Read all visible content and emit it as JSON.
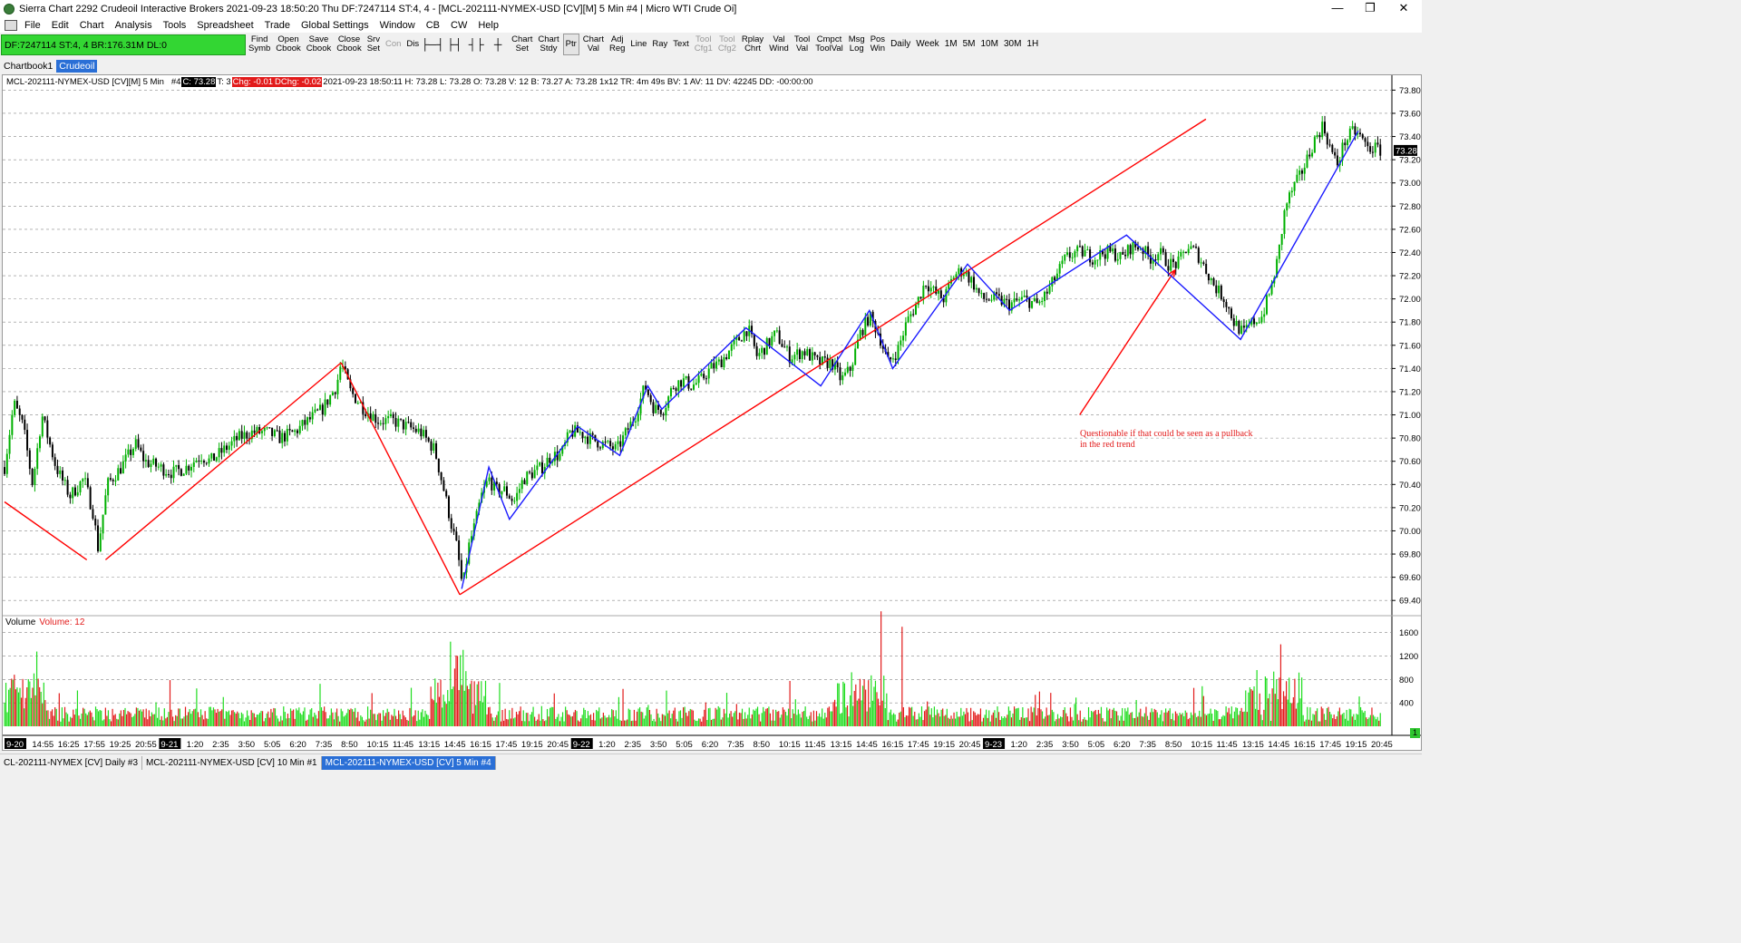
{
  "window": {
    "title": "Sierra Chart 2292 Crudeoil  Interactive Brokers 2021-09-23  18:50:20 Thu  DF:7247114  ST:4, 4 - [MCL-202111-NYMEX-USD [CV][M]  5 Min  #4 | Micro WTI Crude Oi]",
    "minimize": "—",
    "restore": "❐",
    "close": "✕"
  },
  "menu": [
    "File",
    "Edit",
    "Chart",
    "Analysis",
    "Tools",
    "Spreadsheet",
    "Trade",
    "Global Settings",
    "Window",
    "CB",
    "CW",
    "Help"
  ],
  "toolbar": {
    "status": "DF:7247114  ST:4, 4  BR:176.31M  DL:0",
    "buttons": [
      {
        "l1": "Find",
        "l2": "Symb",
        "dis": false
      },
      {
        "l1": "Open",
        "l2": "Cbook",
        "dis": false
      },
      {
        "l1": "Save",
        "l2": "Cbook",
        "dis": false
      },
      {
        "l1": "Close",
        "l2": "Cbook",
        "dis": false
      },
      {
        "l1": "Srv",
        "l2": "Set",
        "dis": false
      },
      {
        "l1": "Con",
        "l2": "",
        "dis": true
      },
      {
        "l1": "Dis",
        "l2": "",
        "dis": false
      }
    ],
    "icon_buttons": [
      "├─┤",
      "├┤",
      "┤├",
      "┼"
    ],
    "buttons2": [
      {
        "l1": "Chart",
        "l2": "Set"
      },
      {
        "l1": "Chart",
        "l2": "Stdy"
      },
      {
        "l1": "Ptr",
        "l2": "",
        "pressed": true
      },
      {
        "l1": "Chart",
        "l2": "Val"
      },
      {
        "l1": "Adj",
        "l2": "Reg"
      },
      {
        "l1": "Line",
        "l2": ""
      },
      {
        "l1": "Ray",
        "l2": ""
      },
      {
        "l1": "Text",
        "l2": ""
      },
      {
        "l1": "Tool",
        "l2": "Cfg1",
        "dis": true
      },
      {
        "l1": "Tool",
        "l2": "Cfg2",
        "dis": true
      },
      {
        "l1": "Rplay",
        "l2": "Chrt"
      },
      {
        "l1": "Val",
        "l2": "Wind"
      },
      {
        "l1": "Tool",
        "l2": "Val"
      },
      {
        "l1": "Cmpct",
        "l2": "ToolVal"
      },
      {
        "l1": "Msg",
        "l2": "Log"
      },
      {
        "l1": "Pos",
        "l2": "Win"
      }
    ],
    "timeframes": [
      "Daily",
      "Week",
      "1M",
      "5M",
      "10M",
      "30M",
      "1H"
    ]
  },
  "tabs": [
    "Chartbook1",
    "Crudeoil"
  ],
  "chart_header": {
    "symbol": "MCL-202111-NYMEX-USD [CV][M]  5 Min",
    "num": "#4",
    "c": "C: 73.28",
    "t": "T: 3",
    "chg": "Chg: -0.01",
    "dchg": "DChg: -0.02",
    "info": "2021-09-23 18:50:11 H: 73.28  L: 73.28  O: 73.28  V: 12  B: 73.27  A: 73.28  1x12  TR: 4m 49s  BV: 1  AV: 11  DV: 42245  DD: -00:00:00"
  },
  "volume_label": {
    "name": "Volume",
    "value": "Volume: 12"
  },
  "annotation": {
    "line1": "Questionable if that could be seen as a pullback",
    "line2": "in the red trend"
  },
  "last_price_label": "73.28",
  "scroll_indicator": "1",
  "bottom_tabs": [
    {
      "label": "CL-202111-NYMEX [CV]  Daily  #3",
      "active": false
    },
    {
      "label": "MCL-202111-NYMEX-USD [CV]  10 Min  #1",
      "active": false
    },
    {
      "label": "MCL-202111-NYMEX-USD [CV]  5 Min  #4",
      "active": true
    }
  ],
  "colors": {
    "up": "#00b000",
    "down": "#e21b1b",
    "red_line": "#ff0000",
    "blue_line": "#1a1aff",
    "accent": "#2a6fd6",
    "status_green": "#33d633"
  },
  "chart_data": {
    "type": "candlestick",
    "price_axis": {
      "ticks": [
        "73.80",
        "73.60",
        "73.40",
        "73.20",
        "73.00",
        "72.80",
        "72.60",
        "72.40",
        "72.20",
        "72.00",
        "71.80",
        "71.60",
        "71.40",
        "71.20",
        "71.00",
        "70.80",
        "70.60",
        "70.40",
        "70.20",
        "70.00",
        "69.80",
        "69.60",
        "69.40"
      ],
      "ylim": [
        69.3,
        73.85
      ]
    },
    "volume_axis": {
      "ticks": [
        "1600",
        "1200",
        "800",
        "400"
      ],
      "ylim": [
        0,
        1750
      ]
    },
    "time_axis": {
      "labels": [
        {
          "t": "9-20",
          "boxed": true
        },
        {
          "t": "14:55"
        },
        {
          "t": "16:25"
        },
        {
          "t": "17:55"
        },
        {
          "t": "19:25"
        },
        {
          "t": "20:55"
        },
        {
          "t": "9-21",
          "boxed": true
        },
        {
          "t": "1:20"
        },
        {
          "t": "2:35"
        },
        {
          "t": "3:50"
        },
        {
          "t": "5:05"
        },
        {
          "t": "6:20"
        },
        {
          "t": "7:35"
        },
        {
          "t": "8:50"
        },
        {
          "t": "10:15"
        },
        {
          "t": "11:45"
        },
        {
          "t": "13:15"
        },
        {
          "t": "14:45"
        },
        {
          "t": "16:15"
        },
        {
          "t": "17:45"
        },
        {
          "t": "19:15"
        },
        {
          "t": "20:45"
        },
        {
          "t": "9-22",
          "boxed": true
        },
        {
          "t": "1:20"
        },
        {
          "t": "2:35"
        },
        {
          "t": "3:50"
        },
        {
          "t": "5:05"
        },
        {
          "t": "6:20"
        },
        {
          "t": "7:35"
        },
        {
          "t": "8:50"
        },
        {
          "t": "10:15"
        },
        {
          "t": "11:45"
        },
        {
          "t": "13:15"
        },
        {
          "t": "14:45"
        },
        {
          "t": "16:15"
        },
        {
          "t": "17:45"
        },
        {
          "t": "19:15"
        },
        {
          "t": "20:45"
        },
        {
          "t": "9-23",
          "boxed": true
        },
        {
          "t": "1:20"
        },
        {
          "t": "2:35"
        },
        {
          "t": "3:50"
        },
        {
          "t": "5:05"
        },
        {
          "t": "6:20"
        },
        {
          "t": "7:35"
        },
        {
          "t": "8:50"
        },
        {
          "t": "10:15"
        },
        {
          "t": "11:45"
        },
        {
          "t": "13:15"
        },
        {
          "t": "14:45"
        },
        {
          "t": "16:15"
        },
        {
          "t": "17:45"
        },
        {
          "t": "19:15"
        },
        {
          "t": "20:45"
        }
      ]
    },
    "price_path": [
      [
        0,
        70.55
      ],
      [
        10,
        71.1
      ],
      [
        20,
        70.9
      ],
      [
        30,
        70.4
      ],
      [
        40,
        71.0
      ],
      [
        55,
        70.55
      ],
      [
        70,
        70.3
      ],
      [
        85,
        70.45
      ],
      [
        95,
        70.15
      ],
      [
        100,
        69.85
      ],
      [
        110,
        70.4
      ],
      [
        125,
        70.55
      ],
      [
        140,
        70.75
      ],
      [
        150,
        70.6
      ],
      [
        165,
        70.55
      ],
      [
        180,
        70.5
      ],
      [
        195,
        70.55
      ],
      [
        210,
        70.65
      ],
      [
        220,
        70.6
      ],
      [
        235,
        70.7
      ],
      [
        250,
        70.8
      ],
      [
        265,
        70.85
      ],
      [
        280,
        70.85
      ],
      [
        295,
        70.8
      ],
      [
        310,
        70.85
      ],
      [
        325,
        70.95
      ],
      [
        340,
        71.05
      ],
      [
        355,
        71.25
      ],
      [
        360,
        71.45
      ],
      [
        370,
        71.2
      ],
      [
        385,
        71.05
      ],
      [
        400,
        70.95
      ],
      [
        415,
        70.95
      ],
      [
        430,
        70.9
      ],
      [
        445,
        70.85
      ],
      [
        460,
        70.7
      ],
      [
        470,
        70.35
      ],
      [
        478,
        70.05
      ],
      [
        484,
        69.85
      ],
      [
        490,
        69.5
      ],
      [
        496,
        69.85
      ],
      [
        503,
        70.05
      ],
      [
        510,
        70.3
      ],
      [
        518,
        70.45
      ],
      [
        525,
        70.35
      ],
      [
        535,
        70.35
      ],
      [
        545,
        70.25
      ],
      [
        555,
        70.45
      ],
      [
        565,
        70.5
      ],
      [
        575,
        70.55
      ],
      [
        585,
        70.65
      ],
      [
        595,
        70.65
      ],
      [
        605,
        70.85
      ],
      [
        615,
        70.85
      ],
      [
        625,
        70.8
      ],
      [
        640,
        70.75
      ],
      [
        655,
        70.7
      ],
      [
        665,
        70.85
      ],
      [
        675,
        71.0
      ],
      [
        685,
        71.25
      ],
      [
        695,
        71.05
      ],
      [
        705,
        71.05
      ],
      [
        715,
        71.25
      ],
      [
        725,
        71.3
      ],
      [
        735,
        71.25
      ],
      [
        745,
        71.3
      ],
      [
        755,
        71.4
      ],
      [
        765,
        71.45
      ],
      [
        775,
        71.55
      ],
      [
        785,
        71.65
      ],
      [
        795,
        71.75
      ],
      [
        805,
        71.5
      ],
      [
        815,
        71.6
      ],
      [
        825,
        71.7
      ],
      [
        840,
        71.5
      ],
      [
        855,
        71.55
      ],
      [
        870,
        71.45
      ],
      [
        885,
        71.45
      ],
      [
        895,
        71.3
      ],
      [
        905,
        71.4
      ],
      [
        915,
        71.7
      ],
      [
        925,
        71.85
      ],
      [
        935,
        71.7
      ],
      [
        945,
        71.45
      ],
      [
        955,
        71.55
      ],
      [
        965,
        71.8
      ],
      [
        975,
        71.95
      ],
      [
        985,
        72.15
      ],
      [
        995,
        72.05
      ],
      [
        1005,
        72.0
      ],
      [
        1015,
        72.2
      ],
      [
        1025,
        72.25
      ],
      [
        1035,
        72.15
      ],
      [
        1045,
        72.0
      ],
      [
        1060,
        72.0
      ],
      [
        1075,
        71.95
      ],
      [
        1090,
        72.0
      ],
      [
        1105,
        71.95
      ],
      [
        1115,
        72.05
      ],
      [
        1125,
        72.2
      ],
      [
        1135,
        72.35
      ],
      [
        1145,
        72.4
      ],
      [
        1155,
        72.4
      ],
      [
        1165,
        72.35
      ],
      [
        1175,
        72.4
      ],
      [
        1185,
        72.4
      ],
      [
        1195,
        72.35
      ],
      [
        1205,
        72.45
      ],
      [
        1215,
        72.45
      ],
      [
        1225,
        72.35
      ],
      [
        1235,
        72.4
      ],
      [
        1245,
        72.3
      ],
      [
        1255,
        72.3
      ],
      [
        1265,
        72.45
      ],
      [
        1275,
        72.4
      ],
      [
        1285,
        72.25
      ],
      [
        1295,
        72.1
      ],
      [
        1305,
        72.0
      ],
      [
        1315,
        71.8
      ],
      [
        1325,
        71.7
      ],
      [
        1335,
        71.8
      ],
      [
        1345,
        71.85
      ],
      [
        1355,
        72.1
      ],
      [
        1362,
        72.35
      ],
      [
        1370,
        72.8
      ],
      [
        1378,
        72.95
      ],
      [
        1385,
        73.05
      ],
      [
        1393,
        73.2
      ],
      [
        1400,
        73.35
      ],
      [
        1410,
        73.5
      ],
      [
        1418,
        73.3
      ],
      [
        1425,
        73.15
      ],
      [
        1433,
        73.35
      ],
      [
        1443,
        73.45
      ],
      [
        1450,
        73.4
      ],
      [
        1458,
        73.3
      ],
      [
        1465,
        73.3
      ],
      [
        1472,
        73.28
      ]
    ],
    "red_lines": [
      [
        [
          70.25,
          0
        ],
        [
          69.75,
          88
        ]
      ],
      [
        [
          69.75,
          108
        ],
        [
          71.45,
          360
        ]
      ],
      [
        [
          71.45,
          360
        ],
        [
          69.45,
          487
        ]
      ],
      [
        [
          69.45,
          487
        ],
        [
          73.55,
          1285
        ]
      ],
      [
        [
          71.0,
          1150
        ],
        [
          72.25,
          1252
        ]
      ]
    ],
    "blue_lines": [
      [
        [
          69.5,
          489
        ],
        [
          70.55,
          518
        ],
        [
          70.1,
          540
        ],
        [
          70.9,
          613
        ],
        [
          70.65,
          658
        ],
        [
          71.25,
          688
        ],
        [
          71.05,
          703
        ],
        [
          71.75,
          793
        ],
        [
          71.25,
          873
        ],
        [
          71.9,
          925
        ],
        [
          71.4,
          950
        ],
        [
          72.3,
          1030
        ],
        [
          71.9,
          1075
        ],
        [
          72.55,
          1200
        ],
        [
          71.65,
          1322
        ],
        [
          73.45,
          1448
        ]
      ]
    ]
  }
}
